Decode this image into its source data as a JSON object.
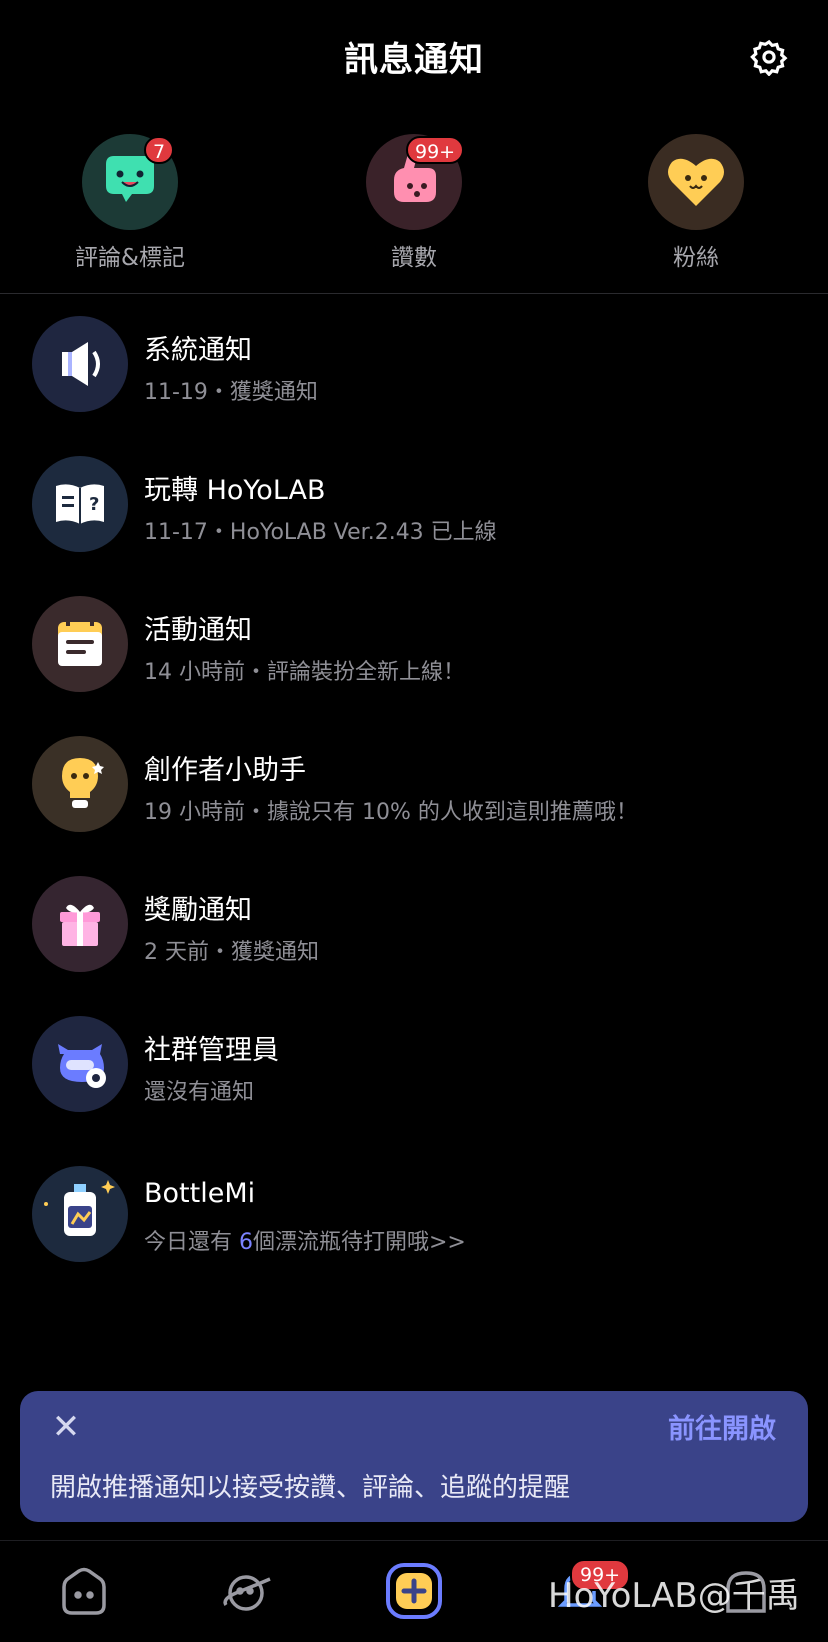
{
  "header": {
    "title": "訊息通知"
  },
  "quick_actions": [
    {
      "label": "評論&標記",
      "badge": "7",
      "icon": "chat-face-icon",
      "bg": "#1c3a36",
      "accent": "#3fe0b0"
    },
    {
      "label": "讚數",
      "badge": "99+",
      "icon": "thumbs-up-icon",
      "bg": "#3a2229",
      "accent": "#ff8fb0"
    },
    {
      "label": "粉絲",
      "badge": "",
      "icon": "heart-face-icon",
      "bg": "#3a2c22",
      "accent": "#ffcd55"
    }
  ],
  "notifications": [
    {
      "title": "系統通知",
      "meta": "11-19・獲獎通知",
      "icon": "megaphone-icon",
      "bg": "#1f2640"
    },
    {
      "title": "玩轉 HoYoLAB",
      "meta": "11-17・HoYoLAB Ver.2.43 已上線",
      "icon": "help-book-icon",
      "bg": "#1d2a3e"
    },
    {
      "title": "活動通知",
      "meta": "14 小時前・評論裝扮全新上線！",
      "icon": "calendar-icon",
      "bg": "#3a2a2c"
    },
    {
      "title": "創作者小助手",
      "meta": "19 小時前・據說只有 10% 的人收到這則推薦哦！",
      "icon": "lightbulb-mascot-icon",
      "bg": "#3a3026"
    },
    {
      "title": "獎勵通知",
      "meta": "2 天前・獲獎通知",
      "icon": "gift-icon",
      "bg": "#352530"
    },
    {
      "title": "社群管理員",
      "meta": "還沒有通知",
      "icon": "moderator-mascot-icon",
      "bg": "#1f2640"
    }
  ],
  "bottlemi": {
    "title": "BottleMi",
    "meta_prefix": "今日還有 ",
    "count": "6",
    "meta_suffix": "個漂流瓶待打開哦>>",
    "icon": "bottle-icon",
    "bg": "#1d2a3e"
  },
  "banner": {
    "close": "✕",
    "action": "前往開啟",
    "text": "開啟推播通知以接受按讚、評論、追蹤的提醒"
  },
  "tabbar": {
    "items": [
      {
        "name": "home",
        "icon": "home-icon"
      },
      {
        "name": "explore",
        "icon": "planet-icon"
      },
      {
        "name": "post",
        "icon": "add-post-icon"
      },
      {
        "name": "notifications",
        "icon": "bell-icon",
        "badge": "99+"
      },
      {
        "name": "profile",
        "icon": "profile-icon"
      }
    ]
  },
  "watermark": "HoYoLAB@千禹",
  "colors": {
    "accent": "#8a94ff",
    "badge": "#e0393e",
    "banner": "#3a4389"
  }
}
